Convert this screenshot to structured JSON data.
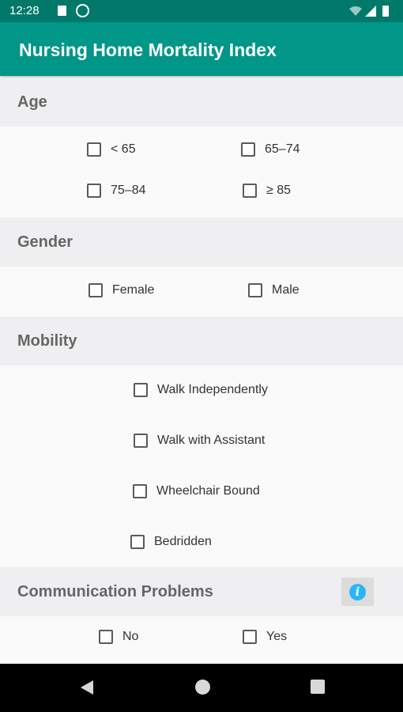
{
  "status_bar": {
    "time": "12:28",
    "icons": [
      "sd-card-icon",
      "data-saver-icon",
      "wifi-icon",
      "signal-icon",
      "battery-icon"
    ]
  },
  "app_bar": {
    "title": "Nursing Home Mortality Index",
    "color": "#009688"
  },
  "sections": {
    "age": {
      "title": "Age",
      "options": [
        "< 65",
        "65–74",
        "75–84",
        "≥ 85"
      ]
    },
    "gender": {
      "title": "Gender",
      "options": [
        "Female",
        "Male"
      ]
    },
    "mobility": {
      "title": "Mobility",
      "options": [
        "Walk Independently",
        "Walk with Assistant",
        "Wheelchair Bound",
        "Bedridden"
      ]
    },
    "communication": {
      "title": "Communication Problems",
      "info_icon": "info-icon",
      "options": [
        "No",
        "Yes"
      ]
    }
  },
  "nav_bar": {
    "icons": [
      "back-icon",
      "home-icon",
      "recents-icon"
    ]
  }
}
